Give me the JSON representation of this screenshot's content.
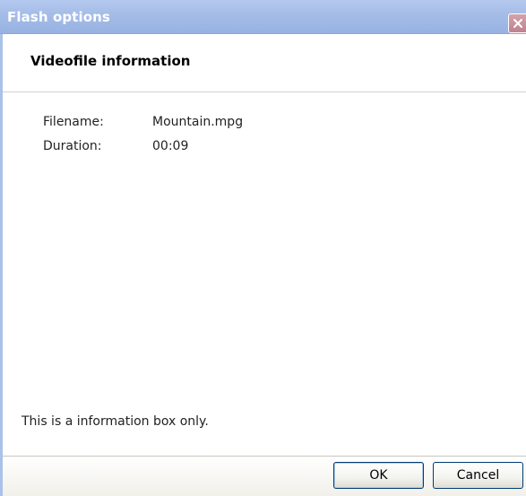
{
  "window": {
    "title": "Flash options"
  },
  "section": {
    "title": "Videofile information"
  },
  "info": {
    "rows": [
      {
        "label": "Filename:",
        "value": "Mountain.mpg"
      },
      {
        "label": "Duration:",
        "value": "00:09"
      }
    ]
  },
  "footer": {
    "note": "This is a information box only."
  },
  "buttons": {
    "ok_label": "OK",
    "cancel_label": "Cancel"
  },
  "icons": {
    "close": "close-icon"
  },
  "colors": {
    "titlebar": "#a6bde8",
    "close_button": "#c88896",
    "button_border": "#003c74"
  }
}
